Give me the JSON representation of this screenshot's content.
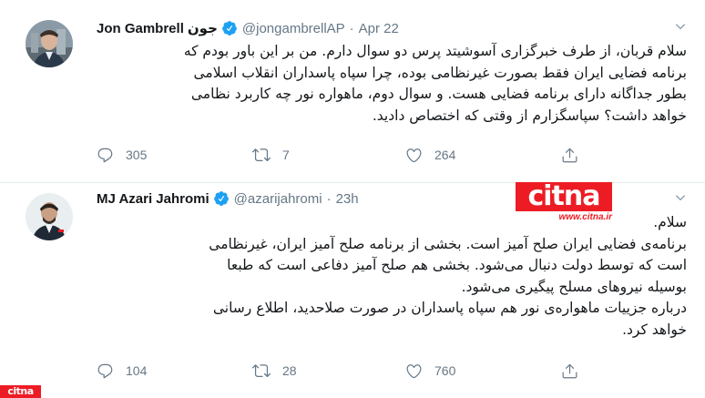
{
  "tweets": [
    {
      "author_name": "Jon Gambrell",
      "author_name_suffix": "جون",
      "handle": "@jongambrellAP",
      "time": "Apr 22",
      "lines": [
        "سلام قربان، از طرف خبرگزاری آسوشیتد پرس دو سوال دارم. من بر این باور بودم که",
        "برنامه فضایی ایران فقط بصورت غیرنظامی بوده، چرا سپاه پاسداران انقلاب اسلامی",
        "بطور جداگانه دارای برنامه فضایی هست. و سوال دوم، ماهواره نور چه کاربرد نظامی",
        "خواهد داشت؟ سپاسگزارم از وقتی که اختصاص دادید."
      ],
      "reply_count": "305",
      "retweet_count": "7",
      "like_count": "264"
    },
    {
      "author_name": "MJ Azari Jahromi",
      "handle": "@azarijahromi",
      "time": "23h",
      "lines": [
        "سلام.",
        "برنامه‌ی فضایی ایران صلح آمیز است. بخشی از برنامه صلح آمیز ایران، غیرنظامی",
        "است که توسط دولت دنبال می‌شود. بخشی هم صلح آمیز دفاعی است که طبعا",
        "بوسیله نیروهای مسلح پیگیری می‌شود.",
        "درباره جزییات ماهواره‌ی نور هم سپاه پاسداران در صورت صلاحدید، اطلاع رسانی",
        "خواهد کرد."
      ],
      "reply_count": "104",
      "retweet_count": "28",
      "like_count": "760"
    }
  ],
  "citna": {
    "logo_text": "citna",
    "url": "www.citna.ir",
    "watermark": "citna",
    "color": "#ED1C24"
  },
  "icons": {
    "verified": "verified-badge-icon",
    "reply": "reply-icon",
    "retweet": "retweet-icon",
    "like": "like-icon",
    "share": "share-icon",
    "caret": "chevron-down-icon"
  },
  "colors": {
    "verified": "#1DA1F2",
    "muted": "#657786",
    "text": "#14171A"
  }
}
